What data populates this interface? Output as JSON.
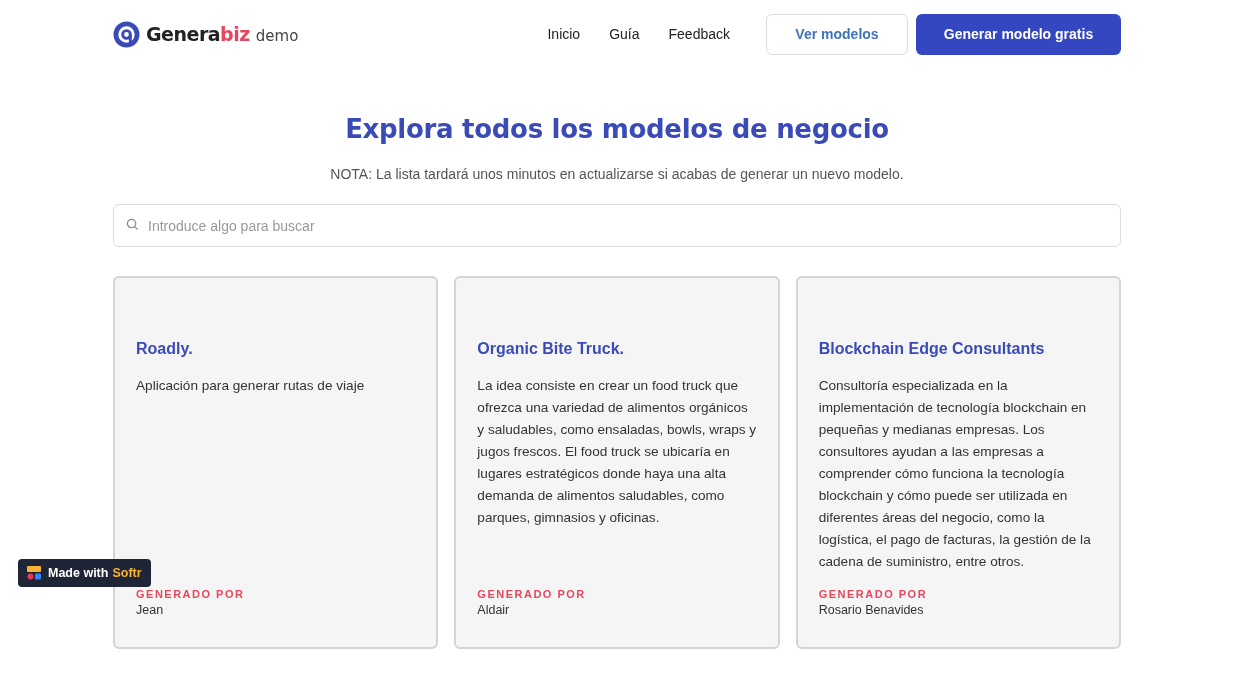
{
  "header": {
    "logo": {
      "name_start": "Genera",
      "name_end": "biz",
      "suffix": "demo"
    },
    "nav": [
      "Inicio",
      "Guía",
      "Feedback"
    ],
    "buttons": [
      {
        "label": "Ver modelos",
        "kind": "outline"
      },
      {
        "label": "Generar modelo gratis",
        "kind": "primary"
      }
    ]
  },
  "heading": "Explora todos los modelos de negocio",
  "note": "NOTA: La lista tardará unos minutos en actualizarse si acabas de generar un nuevo modelo.",
  "search": {
    "placeholder": "Introduce algo para buscar"
  },
  "cards": [
    {
      "title": "Roadly.",
      "description": "Aplicación para generar rutas de viaje",
      "author_label": "GENERADO POR",
      "author": "Jean"
    },
    {
      "title": "Organic Bite Truck.",
      "description": "La idea consiste en crear un food truck que ofrezca una variedad de alimentos orgánicos y saludables, como ensaladas, bowls, wraps y jugos frescos. El food truck se ubicaría en lugares estratégicos donde haya una alta demanda de alimentos saludables, como parques, gimnasios y oficinas.",
      "author_label": "GENERADO POR",
      "author": "Aldair"
    },
    {
      "title": "Blockchain Edge Consultants",
      "description": "Consultoría especializada en la implementación de tecnología blockchain en pequeñas y medianas empresas. Los consultores ayudan a las empresas a comprender cómo funciona la tecnología blockchain y cómo puede ser utilizada en diferentes áreas del negocio, como la logística, el pago de facturas, la gestión de la cadena de suministro, entre otros.",
      "author_label": "GENERADO POR",
      "author": "Rosario Benavides"
    }
  ],
  "badge": {
    "prefix": "Made with",
    "brand": "Softr"
  }
}
